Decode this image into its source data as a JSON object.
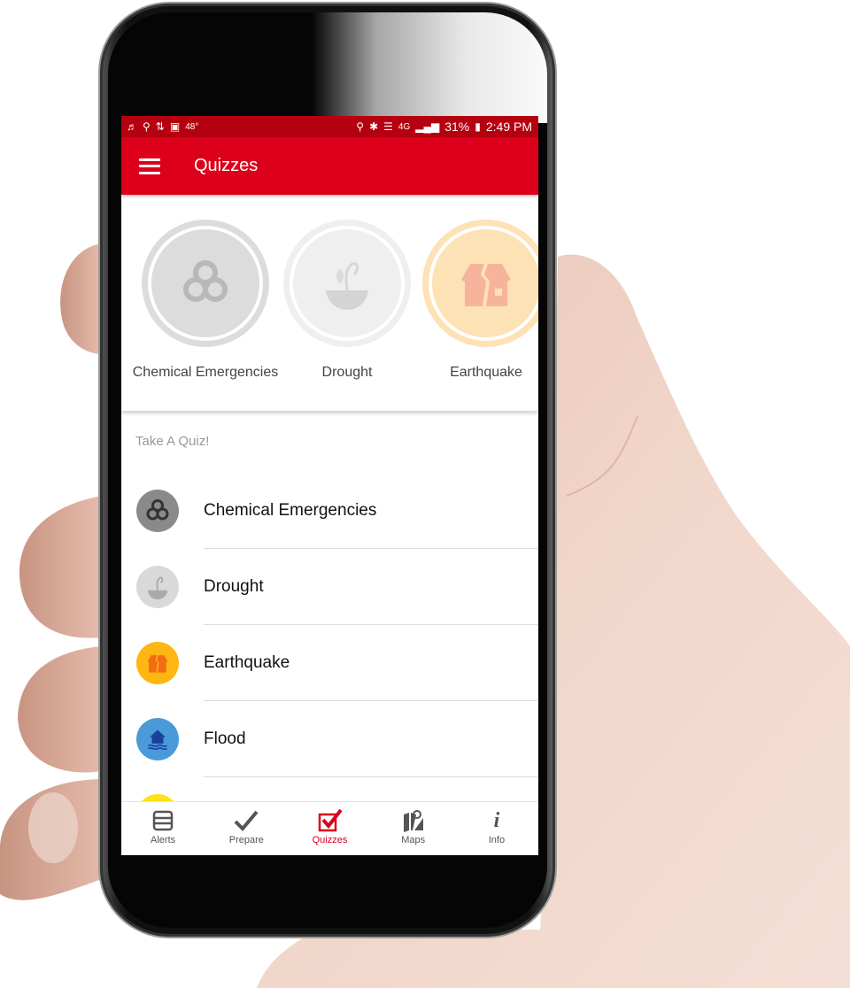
{
  "status_bar": {
    "left_icons": [
      "music-icon",
      "maps-notification-icon",
      "sync-icon",
      "image-icon"
    ],
    "temperature": "48°",
    "right_icons": [
      "location-icon",
      "bluetooth-icon",
      "vibrate-mute-icon",
      "lte-4g-icon",
      "signal-icon"
    ],
    "network": "4G",
    "battery": "31%",
    "time": "2:49 PM"
  },
  "app_bar": {
    "title": "Quizzes",
    "menu_icon": "hamburger-menu-icon"
  },
  "badges": [
    {
      "label": "Chemical Emergencies",
      "icon": "biohazard-icon",
      "color": "#dcdcdc"
    },
    {
      "label": "Drought",
      "icon": "wilted-plant-icon",
      "color": "#efefef"
    },
    {
      "label": "Earthquake",
      "icon": "cracked-house-icon",
      "color": "#fde2b6"
    }
  ],
  "section": {
    "title": "Take A Quiz!"
  },
  "quiz_list": [
    {
      "label": "Chemical Emergencies",
      "icon": "biohazard-icon",
      "color": "#8a8a8a"
    },
    {
      "label": "Drought",
      "icon": "wilted-plant-icon",
      "color": "#d9d9d9"
    },
    {
      "label": "Earthquake",
      "icon": "cracked-house-icon",
      "color": "#ffb612"
    },
    {
      "label": "Flood",
      "icon": "flooded-house-icon",
      "color": "#4a9ad9"
    },
    {
      "label": "",
      "icon": "sun-icon",
      "color": "#ffe01a"
    }
  ],
  "bottom_nav": [
    {
      "label": "Alerts",
      "icon": "list-icon",
      "active": false
    },
    {
      "label": "Prepare",
      "icon": "checkmark-icon",
      "active": false
    },
    {
      "label": "Quizzes",
      "icon": "checkbox-checked-icon",
      "active": true
    },
    {
      "label": "Maps",
      "icon": "map-pin-icon",
      "active": false
    },
    {
      "label": "Info",
      "icon": "info-icon",
      "active": false
    }
  ],
  "colors": {
    "status_bar": "#b5000f",
    "app_bar": "#dc001a",
    "accent": "#d9001a"
  }
}
